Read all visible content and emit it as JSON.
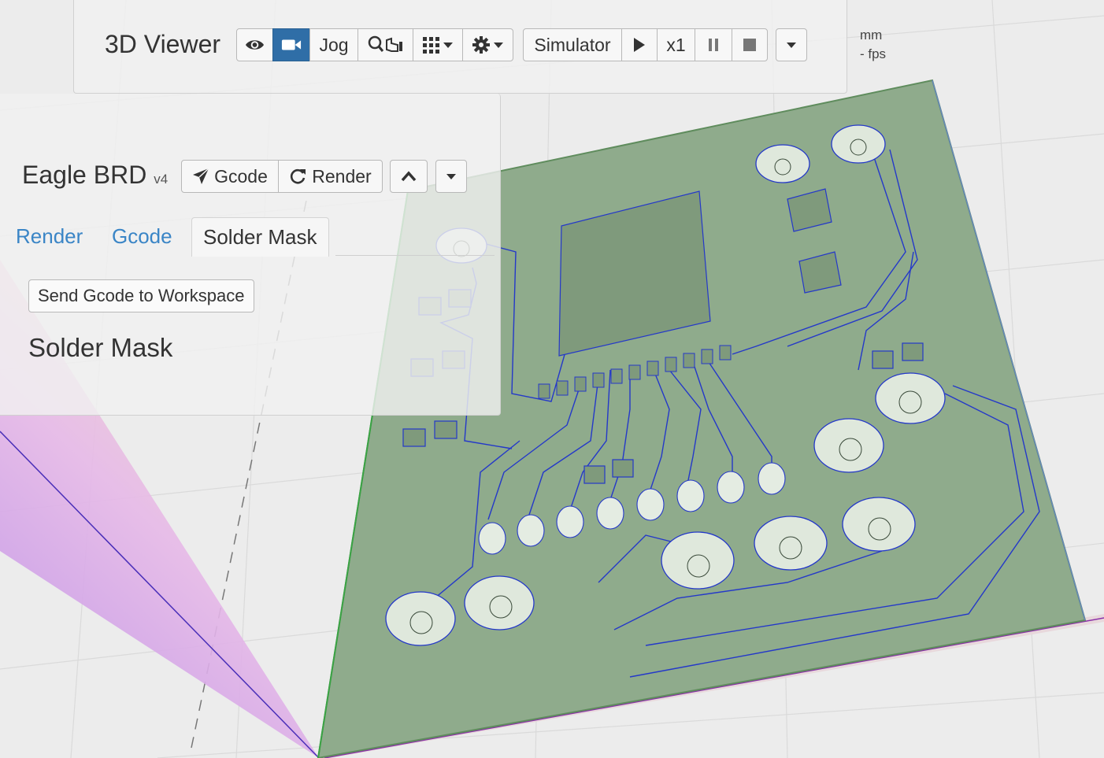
{
  "viewer": {
    "title": "3D Viewer",
    "buttons": {
      "jog": "Jog",
      "simulator": "Simulator",
      "speed": "x1"
    },
    "units": "mm",
    "fps": "- fps",
    "colors": {
      "active": "#2f6ea7",
      "board": "#8fab8c",
      "trace": "#2438c9"
    }
  },
  "eagle": {
    "title": "Eagle BRD",
    "version": "v4",
    "buttons": {
      "gcode": "Gcode",
      "render": "Render"
    },
    "tabs": [
      {
        "label": "Render",
        "active": false
      },
      {
        "label": "Gcode",
        "active": false
      },
      {
        "label": "Solder Mask",
        "active": true
      }
    ],
    "send_button": "Send Gcode to Workspace",
    "heading": "Solder Mask"
  }
}
